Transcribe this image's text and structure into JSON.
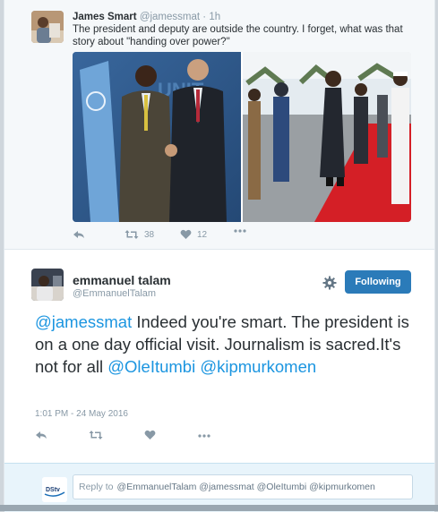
{
  "parent_tweet": {
    "author_name": "James Smart",
    "author_handle": "@jamessmat",
    "separator": "·",
    "time": "1h",
    "text": "The president and deputy are outside the country. I forget, what was that story about \"handing over power?\"",
    "retweets": "38",
    "likes": "12",
    "icons": [
      "reply-icon",
      "retweet-icon",
      "heart-icon",
      "more-icon"
    ]
  },
  "focused_tweet": {
    "author_name": "emmanuel talam",
    "author_handle": "@EmmanuelTalam",
    "follow_label": "Following",
    "text_parts": {
      "mention1": "@jamessmat",
      "body": " Indeed you're smart. The president is on a one day official visit. Journalism is sacred.It's not for all ",
      "mention2": "@OleItumbi",
      "mention3": "@kipmurkomen"
    },
    "timestamp": "1:01 PM - 24 May 2016",
    "icons": [
      "reply-icon",
      "retweet-icon",
      "heart-icon",
      "more-icon",
      "gear-icon"
    ]
  },
  "reply_box": {
    "prefix": "Reply to",
    "recipients": "@EmmanuelTalam @jamessmat @OleItumbi @kipmurkomen",
    "avatar_label": "DStv"
  },
  "colors": {
    "accent": "#2b7bb9",
    "mention": "#1b95e0",
    "muted": "#8899a6",
    "carpet": "#d41f26"
  }
}
